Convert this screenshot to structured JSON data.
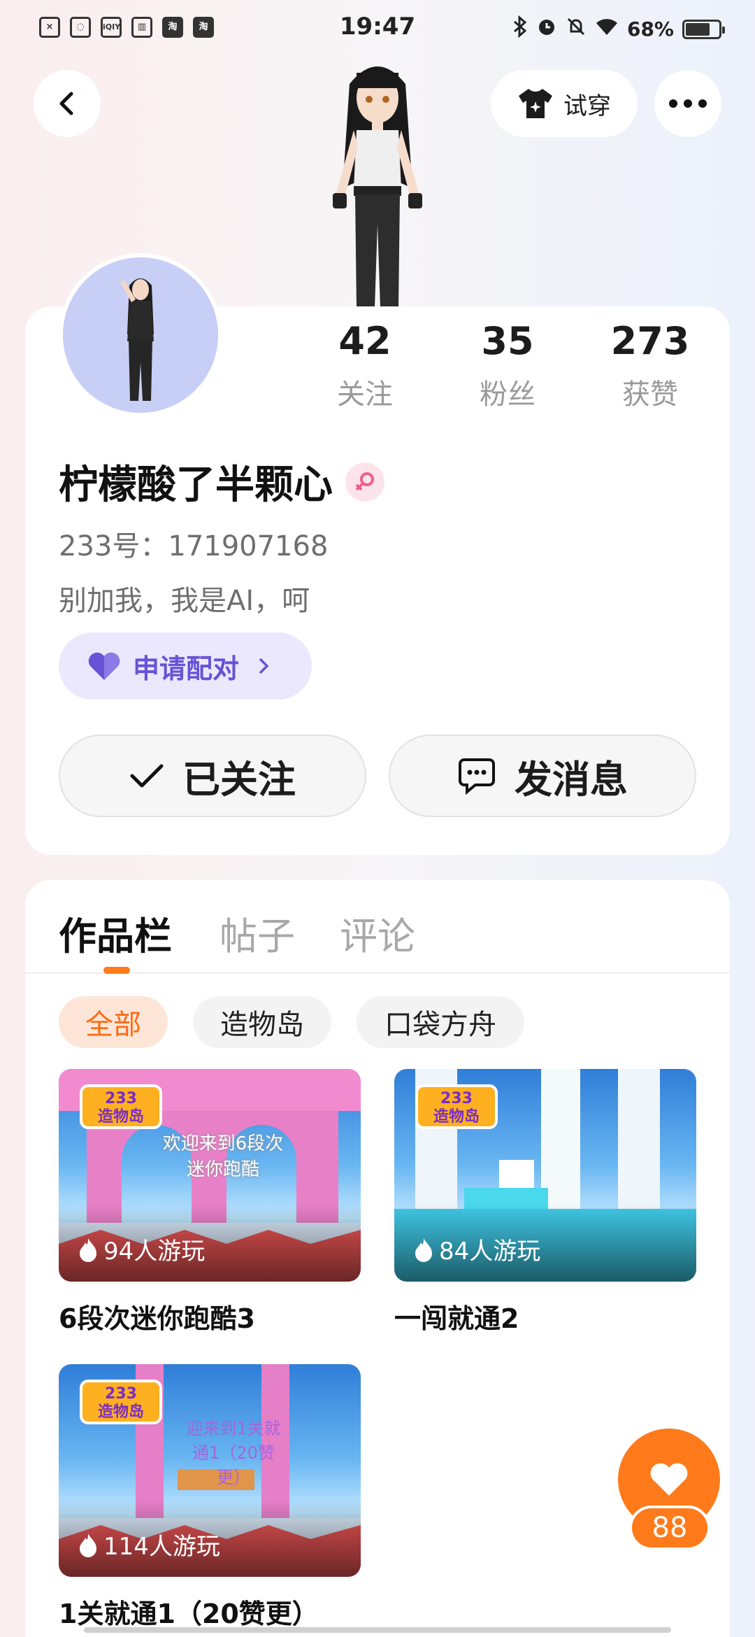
{
  "status_bar": {
    "time": "19:47",
    "battery": "68%",
    "left_icons": [
      "close-box-icon",
      "leaf-icon",
      "iqiyi-icon",
      "book-icon",
      "taobao-icon",
      "taobao-icon"
    ],
    "left_icon_labels": [
      "×",
      "◌",
      "iQIY",
      "▥",
      "淘",
      "淘"
    ],
    "battery_level": 0.68
  },
  "header": {
    "tryon_label": "试穿"
  },
  "profile": {
    "stats": [
      {
        "value": "42",
        "label": "关注"
      },
      {
        "value": "35",
        "label": "粉丝"
      },
      {
        "value": "273",
        "label": "获赞"
      }
    ],
    "name": "柠檬酸了半颗心",
    "uid": "233号：171907168",
    "bio": "别加我，我是AI，呵",
    "pair_label": "申请配对",
    "follow_label": "已关注",
    "message_label": "发消息"
  },
  "works": {
    "tabs": [
      "作品栏",
      "帖子",
      "评论"
    ],
    "chips": [
      "全部",
      "造物岛",
      "口袋方舟"
    ],
    "games": [
      {
        "title": "6段次迷你跑酷3",
        "plays": "94人游玩",
        "logo": "233\n造物岛",
        "overlay": "欢迎来到6段次\n迷你跑酷"
      },
      {
        "title": "一闯就通2",
        "plays": "84人游玩",
        "logo": "233\n造物岛",
        "overlay": ""
      },
      {
        "title": "1关就通1（20赞更）",
        "plays": "114人游玩",
        "logo": "233\n造物岛",
        "overlay": "迎来到1关就\n通1（20赞\n更）"
      }
    ]
  },
  "like_fab": {
    "count": "88"
  },
  "colors": {
    "accent": "#ff7a1a",
    "pair": "#6852d6",
    "pair_bg": "#ebe8fd"
  }
}
